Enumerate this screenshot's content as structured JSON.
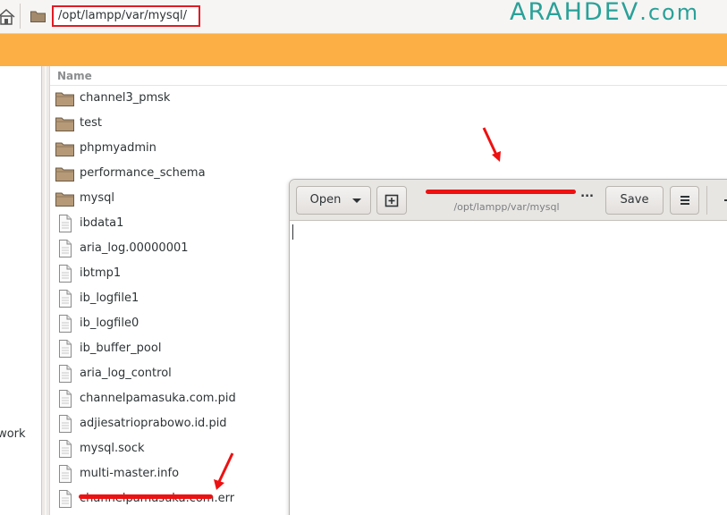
{
  "location": {
    "path": "/opt/lampp/var/mysql/"
  },
  "brand": {
    "part1": "ARAHDEV",
    "part2": ".com"
  },
  "sidebar": {
    "network_label": "twork"
  },
  "file_list": {
    "column_name": "Name",
    "items": [
      {
        "name": "channel3_pmsk",
        "type": "folder"
      },
      {
        "name": "test",
        "type": "folder"
      },
      {
        "name": "phpmyadmin",
        "type": "folder"
      },
      {
        "name": "performance_schema",
        "type": "folder"
      },
      {
        "name": "mysql",
        "type": "folder"
      },
      {
        "name": "ibdata1",
        "type": "file"
      },
      {
        "name": "aria_log.00000001",
        "type": "file"
      },
      {
        "name": "ibtmp1",
        "type": "file"
      },
      {
        "name": "ib_logfile1",
        "type": "file"
      },
      {
        "name": "ib_logfile0",
        "type": "file"
      },
      {
        "name": "ib_buffer_pool",
        "type": "file"
      },
      {
        "name": "aria_log_control",
        "type": "file"
      },
      {
        "name": "channelpamasuka.com.pid",
        "type": "file"
      },
      {
        "name": "adjiesatrioprabowo.id.pid",
        "type": "file"
      },
      {
        "name": "mysql.sock",
        "type": "file"
      },
      {
        "name": "multi-master.info",
        "type": "file"
      },
      {
        "name": "channelpamasuka.com.err",
        "type": "file"
      }
    ]
  },
  "editor": {
    "open_label": "Open",
    "save_label": "Save",
    "title": "...",
    "subtitle": "/opt/lampp/var/mysql"
  },
  "colors": {
    "accent_orange": "#fbaf44",
    "annotation_red": "#ee1111",
    "brand_teal": "#2aa198"
  },
  "icons": [
    "home-icon",
    "folder-icon",
    "file-icon",
    "new-tab-icon",
    "hamburger-menu-icon",
    "minimize-icon"
  ]
}
